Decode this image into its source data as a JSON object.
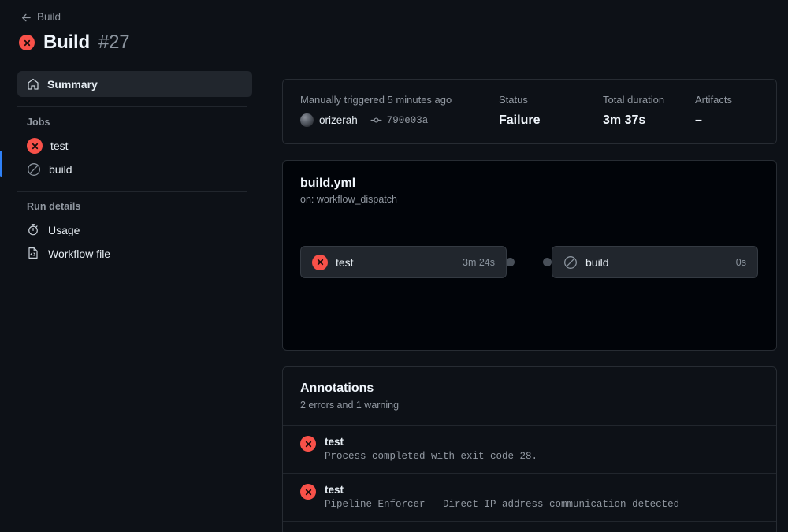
{
  "header": {
    "back_label": "Build",
    "back_icon": "arrow-left-icon",
    "status_icon": "failure-x-icon",
    "title": "Build",
    "run_number": "#27"
  },
  "sidebar": {
    "summary": {
      "label": "Summary",
      "icon": "home-icon"
    },
    "jobs_label": "Jobs",
    "jobs": [
      {
        "label": "test",
        "icon": "failure-x-icon",
        "status": "failure"
      },
      {
        "label": "build",
        "icon": "skipped-slash-icon",
        "status": "skipped"
      }
    ],
    "run_details_label": "Run details",
    "run_details": [
      {
        "label": "Usage",
        "icon": "stopwatch-icon"
      },
      {
        "label": "Workflow file",
        "icon": "file-code-icon"
      }
    ]
  },
  "info": {
    "trigger_label": "Manually triggered 5 minutes ago",
    "actor": "orizerah",
    "actor_avatar": "user-avatar",
    "commit_icon": "commit-icon",
    "commit_sha": "790e03a",
    "status_label": "Status",
    "status_value": "Failure",
    "duration_label": "Total duration",
    "duration_value": "3m 37s",
    "artifacts_label": "Artifacts",
    "artifacts_value": "–"
  },
  "workflow": {
    "file_name": "build.yml",
    "trigger": "on: workflow_dispatch",
    "nodes": [
      {
        "name": "test",
        "duration": "3m 24s",
        "icon": "failure-x-icon",
        "status": "failure"
      },
      {
        "name": "build",
        "duration": "0s",
        "icon": "skipped-slash-icon",
        "status": "skipped"
      }
    ]
  },
  "annotations": {
    "title": "Annotations",
    "summary": "2 errors and 1 warning",
    "items": [
      {
        "job": "test",
        "message": "Process completed with exit code 28.",
        "icon": "failure-x-icon",
        "level": "error"
      },
      {
        "job": "test",
        "message": "Pipeline Enforcer - Direct IP address communication detected",
        "icon": "failure-x-icon",
        "level": "error"
      }
    ]
  },
  "colors": {
    "page_bg": "#0d1117",
    "card_bg": "#0d1117",
    "graph_bg": "#010409",
    "border": "#272c33",
    "accent_blue": "#2f81f7",
    "failure_red": "#f85149",
    "muted_text": "#9198a1"
  }
}
